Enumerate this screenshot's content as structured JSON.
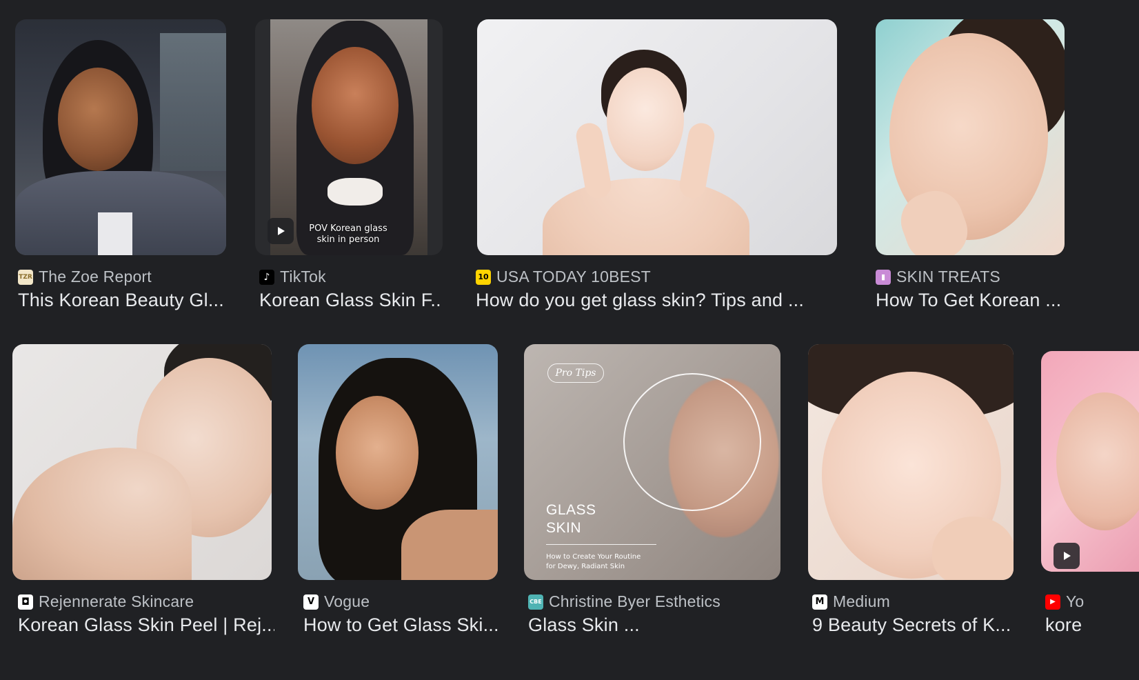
{
  "results": [
    {
      "source": "The Zoe Report",
      "title": "This Korean Beauty Gl...",
      "favicon_text": "TZR",
      "favicon_bg": "#f2e6c8",
      "favicon_fg": "#8a6d2a",
      "is_video": false
    },
    {
      "source": "TikTok",
      "title": "Korean Glass Skin F...",
      "favicon_text": "♪",
      "favicon_bg": "#000000",
      "favicon_fg": "#ffffff",
      "is_video": true,
      "overlay_text": "POV Korean glass\nskin in person"
    },
    {
      "source": "USA TODAY 10BEST",
      "title": "How do you get glass skin? Tips and ...",
      "favicon_text": "10",
      "favicon_bg": "#ffd400",
      "favicon_fg": "#000000",
      "is_video": false
    },
    {
      "source": "SKIN TREATS",
      "title": "How To Get Korean ...",
      "favicon_text": "▮",
      "favicon_bg": "#c98bd6",
      "favicon_fg": "#ffffff",
      "is_video": false
    },
    {
      "source": "Rejennerate Skincare",
      "title": "Korean Glass Skin Peel | Rej...",
      "favicon_text": "◘",
      "favicon_bg": "#ffffff",
      "favicon_fg": "#000000",
      "is_video": false
    },
    {
      "source": "Vogue",
      "title": "How to Get Glass Ski...",
      "favicon_text": "V",
      "favicon_bg": "#ffffff",
      "favicon_fg": "#000000",
      "is_video": false
    },
    {
      "source": "Christine Byer Esthetics",
      "title": "Glass Skin ...",
      "favicon_text": "CBE",
      "favicon_bg": "#4fb3b3",
      "favicon_fg": "#ffffff",
      "is_video": false,
      "overlay_pill": "Pro Tips",
      "overlay_heading": "GLASS\nSKIN",
      "overlay_sub": "How to Create Your Routine\nfor Dewy, Radiant Skin"
    },
    {
      "source": "Medium",
      "title": "9 Beauty Secrets of K...",
      "favicon_text": "M",
      "favicon_bg": "#ffffff",
      "favicon_fg": "#000000",
      "is_video": false
    },
    {
      "source": "Yo",
      "title": "kore",
      "favicon_text": "▶",
      "favicon_bg": "#ff0000",
      "favicon_fg": "#ffffff",
      "is_video": true
    }
  ],
  "icons": {
    "play": "play-icon"
  }
}
